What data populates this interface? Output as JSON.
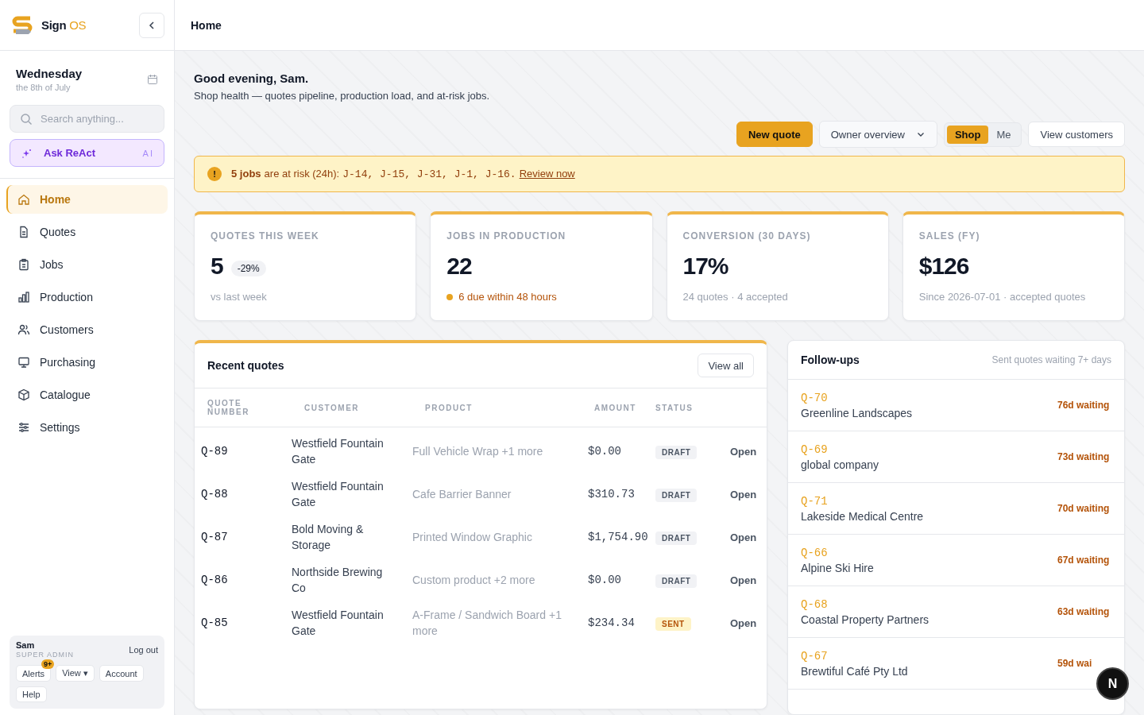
{
  "brand": {
    "name": "Sign",
    "suffix": "OS"
  },
  "date": {
    "day": "Wednesday",
    "detail": "the 8th of July"
  },
  "search": {
    "placeholder": "Search anything..."
  },
  "assistant": {
    "label": "Ask ReAct",
    "badge": "AI"
  },
  "nav": [
    {
      "label": "Home",
      "selected": true
    },
    {
      "label": "Quotes",
      "selected": false
    },
    {
      "label": "Jobs",
      "selected": false
    },
    {
      "label": "Production",
      "selected": false
    },
    {
      "label": "Customers",
      "selected": false
    },
    {
      "label": "Purchasing",
      "selected": false
    },
    {
      "label": "Catalogue",
      "selected": false
    },
    {
      "label": "Settings",
      "selected": false
    }
  ],
  "user": {
    "name": "Sam",
    "role": "SUPER ADMIN",
    "logout": "Log out",
    "buttons": [
      "Alerts",
      "View ▾",
      "Account",
      "Help"
    ],
    "alerts_badge": "9+"
  },
  "header": {
    "title": "Home"
  },
  "greeting": {
    "title": "Good evening, Sam.",
    "subtitle": "Shop health — quotes pipeline, production load, and at-risk jobs."
  },
  "toolbar": {
    "primary": "New quote",
    "dropdown": "Owner overview",
    "toggle": [
      {
        "label": "Shop",
        "selected": true
      },
      {
        "label": "Me",
        "selected": false
      }
    ],
    "secondary": "View customers"
  },
  "alert": {
    "icon": "!",
    "count": "5 jobs",
    "text": "are at risk (24h):",
    "jobs": "J-14, J-15, J-31, J-1, J-16.",
    "link": "Review now"
  },
  "stats": [
    {
      "label": "QUOTES THIS WEEK",
      "value": "5",
      "delta": "-29%",
      "note": "vs last week",
      "warning": false
    },
    {
      "label": "JOBS IN PRODUCTION",
      "value": "22",
      "note": "6 due within 48 hours",
      "warning": true
    },
    {
      "label": "CONVERSION (30 DAYS)",
      "value": "17%",
      "note": "24 quotes · 4 accepted",
      "warning": false
    },
    {
      "label": "SALES (FY)",
      "value": "$126",
      "note": "Since 2026-07-01 · accepted quotes",
      "warning": false
    }
  ],
  "recent_quotes": {
    "title": "Recent quotes",
    "action": "View all",
    "columns": [
      "QUOTE NUMBER",
      "CUSTOMER",
      "PRODUCT",
      "AMOUNT",
      "STATUS"
    ],
    "rows": [
      {
        "quote": "Q-89",
        "customer": "Westfield Fountain Gate",
        "product": "Full Vehicle Wrap +1 more",
        "amount": "$0.00",
        "status": "DRAFT",
        "kind": "draft",
        "action": "Open"
      },
      {
        "quote": "Q-88",
        "customer": "Westfield Fountain Gate",
        "product": "Cafe Barrier Banner",
        "amount": "$310.73",
        "status": "DRAFT",
        "kind": "draft",
        "action": "Open"
      },
      {
        "quote": "Q-87",
        "customer": "Bold Moving & Storage",
        "product": "Printed Window Graphic",
        "amount": "$1,754.90",
        "status": "DRAFT",
        "kind": "draft",
        "action": "Open"
      },
      {
        "quote": "Q-86",
        "customer": "Northside Brewing Co",
        "product": "Custom product +2 more",
        "amount": "$0.00",
        "status": "DRAFT",
        "kind": "draft",
        "action": "Open"
      },
      {
        "quote": "Q-85",
        "customer": "Westfield Fountain Gate",
        "product": "A-Frame / Sandwich Board +1 more",
        "amount": "$234.34",
        "status": "SENT",
        "kind": "sent",
        "action": "Open"
      }
    ]
  },
  "followups": {
    "title": "Follow-ups",
    "subtitle": "Sent quotes waiting 7+ days",
    "items": [
      {
        "quote": "Q-70",
        "customer": "Greenline Landscapes",
        "waiting": "76d waiting"
      },
      {
        "quote": "Q-69",
        "customer": "global company",
        "waiting": "73d waiting"
      },
      {
        "quote": "Q-71",
        "customer": "Lakeside Medical Centre",
        "waiting": "70d waiting"
      },
      {
        "quote": "Q-66",
        "customer": "Alpine Ski Hire",
        "waiting": "67d waiting"
      },
      {
        "quote": "Q-68",
        "customer": "Coastal Property Partners",
        "waiting": "63d waiting"
      },
      {
        "quote": "Q-67",
        "customer": "Brewtiful Café Pty Ltd",
        "waiting": "59d wai"
      }
    ]
  },
  "floating_button": {
    "label": "N"
  }
}
